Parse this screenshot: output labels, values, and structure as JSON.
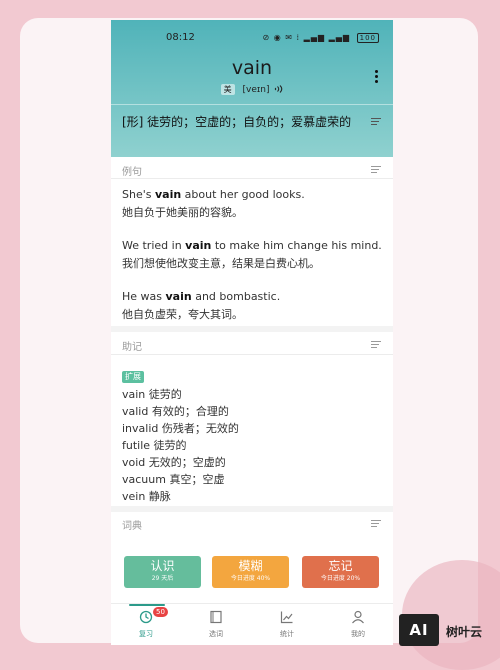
{
  "status_bar": {
    "time": "08:12",
    "icons": "⊘ ◉ ✉ ⁞ ▂▄▆ ▂▄▆",
    "battery": "100"
  },
  "word": {
    "headword": "vain",
    "accent_label": "美",
    "phonetic": "[veɪn]",
    "audio_icon": "speaker-icon",
    "definition": "[形] 徒劳的；空虚的；自负的；爱慕虚荣的"
  },
  "examples": {
    "title": "例句",
    "items": [
      {
        "en_before": "She's ",
        "keyword": "vain",
        "en_after": " about her good looks.",
        "zh": "她自负于她美丽的容貌。"
      },
      {
        "en_before": "We tried in ",
        "keyword": "vain",
        "en_after": " to make him change his mind.",
        "zh": "我们想使他改变主意，结果是白费心机。"
      },
      {
        "en_before": "He was ",
        "keyword": "vain",
        "en_after": " and bombastic.",
        "zh": "他自负虚荣，夸大其词。"
      }
    ]
  },
  "mnemonic": {
    "title": "助记",
    "badge": "扩展",
    "items": [
      "vain 徒劳的",
      "valid 有效的；合理的",
      "invalid 伤残者；无效的",
      "futile 徒劳的",
      "void 无效的；空虚的",
      "vacuum 真空；空虚",
      "vein 静脉"
    ]
  },
  "dictionary": {
    "title": "词典"
  },
  "actions": {
    "know": {
      "label": "认识",
      "sub": "29 天后"
    },
    "vague": {
      "label": "模糊",
      "sub": "今日进度 40%"
    },
    "forget": {
      "label": "忘记",
      "sub": "今日进度 20%"
    }
  },
  "tabbar": {
    "review": {
      "label": "复习",
      "badge": "50"
    },
    "select": {
      "label": "选词"
    },
    "stats": {
      "label": "统计"
    },
    "mine": {
      "label": "我的"
    }
  },
  "watermark": {
    "logo": "AI",
    "text": "树叶云"
  },
  "colors": {
    "header_top": "#50b3b9",
    "know": "#65bd9c",
    "vague": "#f3a63f",
    "forget": "#e0704c",
    "accent": "#2c9a8a"
  }
}
